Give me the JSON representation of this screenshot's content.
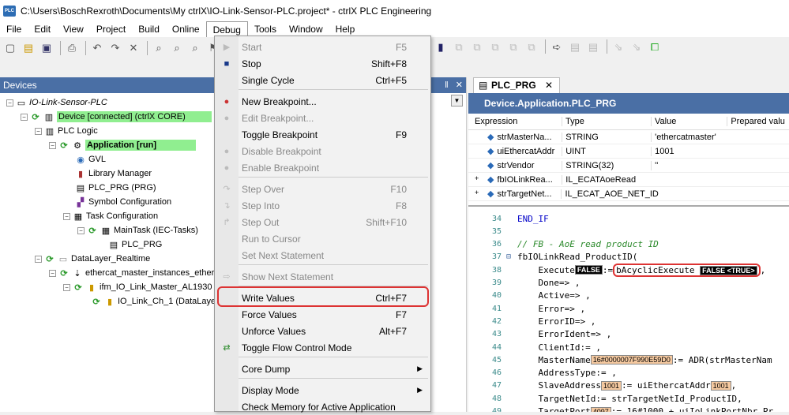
{
  "window": {
    "title": "C:\\Users\\BoschRexroth\\Documents\\My ctrlX\\IO-Link-Sensor-PLC.project* - ctrlX PLC Engineering",
    "icon": "PLC"
  },
  "menu": [
    "File",
    "Edit",
    "View",
    "Project",
    "Build",
    "Online",
    "Debug",
    "Tools",
    "Window",
    "Help"
  ],
  "devices": {
    "title": "Devices",
    "pin": "‖",
    "close": "✕",
    "tree": [
      {
        "label": "IO-Link-Sensor-PLC",
        "italic": true
      },
      {
        "label": "Device [connected] (ctrlX CORE)"
      },
      {
        "label": "PLC Logic"
      },
      {
        "label": "Application [run]"
      },
      {
        "label": "GVL"
      },
      {
        "label": "Library Manager"
      },
      {
        "label": "PLC_PRG (PRG)"
      },
      {
        "label": "Symbol Configuration"
      },
      {
        "label": "Task Configuration"
      },
      {
        "label": "MainTask (IEC-Tasks)"
      },
      {
        "label": "PLC_PRG"
      },
      {
        "label": "DataLayer_Realtime"
      },
      {
        "label": "ethercat_master_instances_ether"
      },
      {
        "label": "ifm_IO_Link_Master_AL1930 ("
      },
      {
        "label": "IO_Link_Ch_1 (DataLayer"
      }
    ]
  },
  "debug_menu": [
    {
      "label": "Start",
      "shortcut": "F5",
      "disabled": true,
      "icon": "play-icon"
    },
    {
      "label": "Stop",
      "shortcut": "Shift+F8",
      "disabled": false,
      "icon": "stop-icon"
    },
    {
      "label": "Single Cycle",
      "shortcut": "Ctrl+F5",
      "disabled": false,
      "icon": ""
    },
    {
      "label": "New Breakpoint...",
      "shortcut": "",
      "disabled": false,
      "icon": "breakpoint-new-icon"
    },
    {
      "label": "Edit Breakpoint...",
      "shortcut": "",
      "disabled": true,
      "icon": "breakpoint-edit-icon"
    },
    {
      "label": "Toggle Breakpoint",
      "shortcut": "F9",
      "disabled": false,
      "icon": ""
    },
    {
      "label": "Disable Breakpoint",
      "shortcut": "",
      "disabled": true,
      "icon": "breakpoint-disable-icon"
    },
    {
      "label": "Enable Breakpoint",
      "shortcut": "",
      "disabled": true,
      "icon": "breakpoint-enable-icon"
    },
    {
      "label": "Step Over",
      "shortcut": "F10",
      "disabled": true,
      "icon": "step-over-icon"
    },
    {
      "label": "Step Into",
      "shortcut": "F8",
      "disabled": true,
      "icon": "step-into-icon"
    },
    {
      "label": "Step Out",
      "shortcut": "Shift+F10",
      "disabled": true,
      "icon": "step-out-icon"
    },
    {
      "label": "Run to Cursor",
      "shortcut": "",
      "disabled": true,
      "icon": ""
    },
    {
      "label": "Set Next Statement",
      "shortcut": "",
      "disabled": true,
      "icon": ""
    },
    {
      "label": "Show Next Statement",
      "shortcut": "",
      "disabled": true,
      "icon": "show-next-icon"
    },
    {
      "label": "Write Values",
      "shortcut": "Ctrl+F7",
      "disabled": false,
      "icon": ""
    },
    {
      "label": "Force Values",
      "shortcut": "F7",
      "disabled": false,
      "icon": ""
    },
    {
      "label": "Unforce Values",
      "shortcut": "Alt+F7",
      "disabled": false,
      "icon": ""
    },
    {
      "label": "Toggle Flow Control Mode",
      "shortcut": "",
      "disabled": false,
      "icon": "flow-control-icon"
    },
    {
      "label": "Core Dump",
      "shortcut": "",
      "disabled": false,
      "icon": "",
      "submenu": true
    },
    {
      "label": "Display Mode",
      "shortcut": "",
      "disabled": false,
      "icon": "",
      "submenu": true
    },
    {
      "label": "Check Memory for Active Application",
      "shortcut": "",
      "disabled": false,
      "icon": ""
    }
  ],
  "editor": {
    "tab": "PLC_PRG",
    "tab_close": "✕",
    "title": "Device.Application.PLC_PRG",
    "columns": [
      "Expression",
      "Type",
      "Value",
      "Prepared valu"
    ],
    "rows": [
      {
        "expr": "strMasterNa...",
        "type": "STRING",
        "value": "'ethercatmaster'",
        "prefix": ""
      },
      {
        "expr": "uiEthercatAddr",
        "type": "UINT",
        "value": "1001",
        "prefix": ""
      },
      {
        "expr": "strVendor",
        "type": "STRING(32)",
        "value": "''",
        "prefix": ""
      },
      {
        "expr": "fbIOLinkRea...",
        "type": "IL_ECATAoeRead",
        "value": "",
        "prefix": "+"
      },
      {
        "expr": "strTargetNet...",
        "type": "IL_ECAT_AOE_NET_ID",
        "value": "",
        "prefix": "+"
      }
    ],
    "code": [
      {
        "n": "34",
        "t": "END_IF"
      },
      {
        "n": "35",
        "t": ""
      },
      {
        "n": "36",
        "t": "// FB - AoE read product ID"
      },
      {
        "n": "37",
        "t": "fbIOLinkRead_ProductID("
      },
      {
        "n": "38",
        "t": "Execute",
        "mv": "FALSE",
        "rest": ":=",
        "box": "bAcyclicExecute",
        "mv2": "FALSE <TRUE>",
        "end": ","
      },
      {
        "n": "39",
        "t": "Done=> ,"
      },
      {
        "n": "40",
        "t": "Active=> ,"
      },
      {
        "n": "41",
        "t": "Error=> ,"
      },
      {
        "n": "42",
        "t": "ErrorID=> ,"
      },
      {
        "n": "43",
        "t": "ErrorIdent=> ,"
      },
      {
        "n": "44",
        "t": "ClientId:= ,"
      },
      {
        "n": "45",
        "t": "MasterName",
        "mv": "16#0000007F990E59D0",
        "rest": ":= ADR(strMasterNam"
      },
      {
        "n": "46",
        "t": "AddressType:= ,"
      },
      {
        "n": "47",
        "t": "SlaveAddress",
        "mv": "1001",
        "rest": ":= uiEthercatAddr",
        "mv2": "1001",
        "end": ","
      },
      {
        "n": "48",
        "t": "TargetNetId:= strTargetNetId_ProductID,"
      },
      {
        "n": "49",
        "t": "TargetPort",
        "mv": "4097",
        "rest": ":= 16#1000 + uiIoLinkPortNbr_Pr"
      }
    ]
  }
}
